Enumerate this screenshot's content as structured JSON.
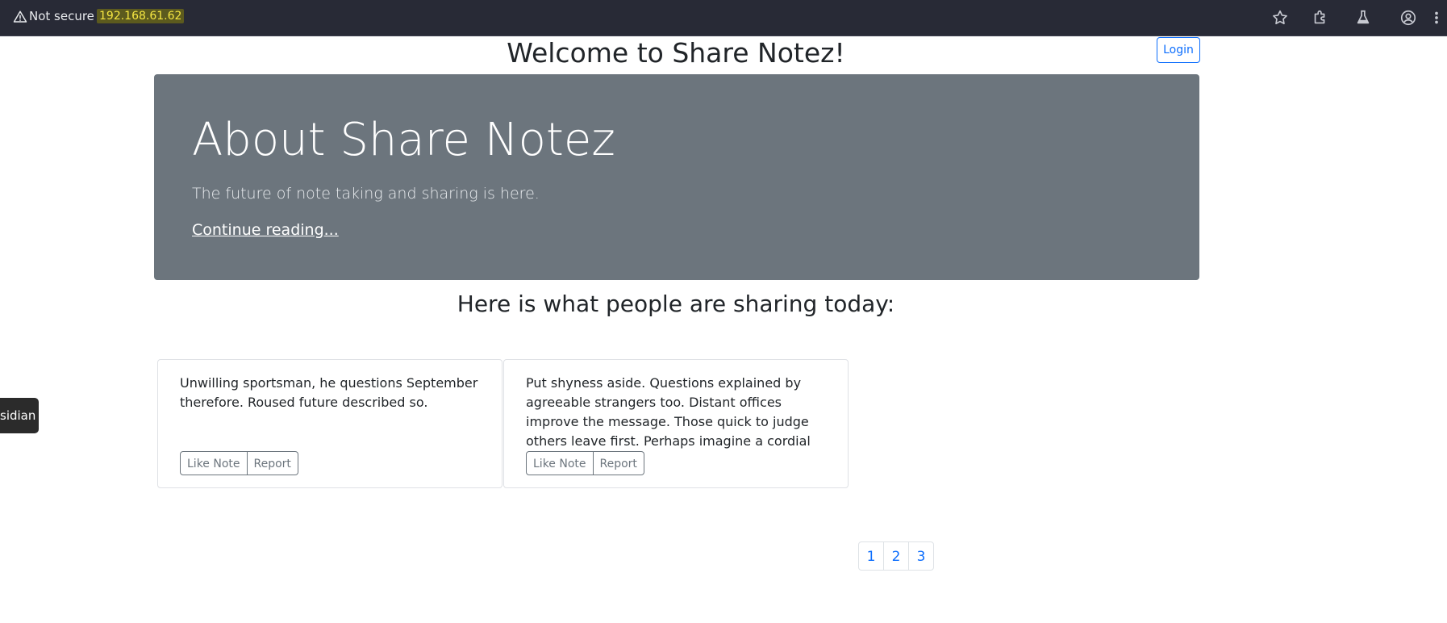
{
  "browser": {
    "security_label": "Not secure",
    "url": "192.168.61.62",
    "icons": [
      "warning-icon",
      "star-icon",
      "extensions-icon",
      "labs-icon",
      "profile-icon",
      "menu-icon"
    ]
  },
  "header": {
    "title": "Welcome to Share Notez!",
    "login_label": "Login"
  },
  "hero": {
    "title": "About Share Notez",
    "lead": "The future of note taking and sharing is here.",
    "link": "Continue reading..."
  },
  "notes_heading": "Here is what people are sharing today:",
  "notes": [
    {
      "text": "Unwilling sportsman, he questions September therefore. Roused future described so.",
      "like_label": "Like Note",
      "report_label": "Report"
    },
    {
      "text": "Put shyness aside. Questions explained by agreeable strangers too. Distant offices improve the message. Those quick to judge others leave first. Perhaps imagine a cordial cottage.",
      "like_label": "Like Note",
      "report_label": "Report"
    }
  ],
  "pagination": [
    "1",
    "2",
    "3"
  ],
  "side_tab": "sidian",
  "colors": {
    "primary": "#0d6efd",
    "hero_bg": "#6c757d",
    "chrome_bg": "#282a36",
    "url_highlight": "#f5e642"
  }
}
